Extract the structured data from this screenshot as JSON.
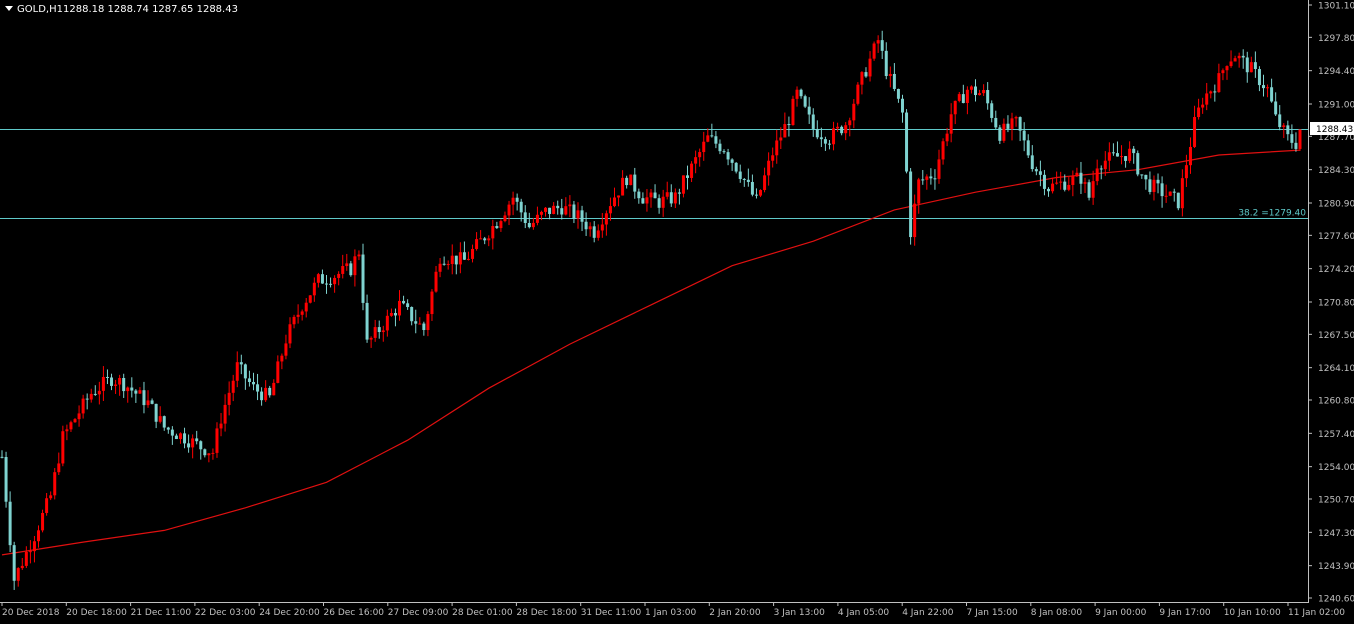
{
  "header": {
    "symbol_timeframe": "GOLD,H1",
    "ohlc": "1288.18 1288.74 1287.65 1288.43"
  },
  "colors": {
    "background": "#000000",
    "bull_candle": "#ff0000",
    "bear_candle": "#7fd3d0",
    "ma_line": "#e01010",
    "hline": "#5fc9c9",
    "axis": "#c0c0c0",
    "price_tag_bg": "#ffffff"
  },
  "price_tag": "1288.43",
  "chart_data": {
    "type": "candlestick",
    "ylim": [
      1240.6,
      1301.1
    ],
    "y_ticks": [
      "1301.10",
      "1297.80",
      "1294.40",
      "1291.00",
      "1287.70",
      "1284.30",
      "1280.90",
      "1277.60",
      "1274.20",
      "1270.80",
      "1267.50",
      "1264.10",
      "1260.80",
      "1257.40",
      "1254.00",
      "1250.70",
      "1247.30",
      "1243.90",
      "1240.60"
    ],
    "x_ticks": [
      "20 Dec 2018",
      "20 Dec 18:00",
      "21 Dec 11:00",
      "22 Dec 03:00",
      "24 Dec 20:00",
      "26 Dec 16:00",
      "27 Dec 09:00",
      "28 Dec 01:00",
      "28 Dec 18:00",
      "31 Dec 11:00",
      "1 Jan 03:00",
      "2 Jan 20:00",
      "3 Jan 13:00",
      "4 Jan 05:00",
      "4 Jan 22:00",
      "7 Jan 15:00",
      "8 Jan 08:00",
      "9 Jan 00:00",
      "9 Jan 17:00",
      "10 Jan 10:00",
      "11 Jan 02:00"
    ],
    "hlines": [
      {
        "value": 1288.43,
        "label": ""
      },
      {
        "value": 1279.4,
        "label": "38.2 =1279.40"
      }
    ],
    "ma_points": [
      [
        0,
        1245.0
      ],
      [
        1,
        1246.3
      ],
      [
        2,
        1247.5
      ],
      [
        3,
        1249.8
      ],
      [
        4,
        1252.4
      ],
      [
        5,
        1256.7
      ],
      [
        6,
        1262.0
      ],
      [
        7,
        1266.5
      ],
      [
        8,
        1270.5
      ],
      [
        9,
        1274.5
      ],
      [
        10,
        1277.0
      ],
      [
        11,
        1280.2
      ],
      [
        12,
        1282.0
      ],
      [
        13,
        1283.5
      ],
      [
        14,
        1284.3
      ],
      [
        15,
        1285.8
      ],
      [
        16,
        1286.3
      ]
    ],
    "anchors": [
      [
        0,
        1255.0
      ],
      [
        3,
        1242.5
      ],
      [
        8,
        1247.0
      ],
      [
        12,
        1251.0
      ],
      [
        15,
        1257.0
      ],
      [
        22,
        1261.5
      ],
      [
        27,
        1263.0
      ],
      [
        30,
        1262.5
      ],
      [
        36,
        1260.5
      ],
      [
        40,
        1258.0
      ],
      [
        45,
        1257.0
      ],
      [
        49,
        1256.0
      ],
      [
        52,
        1255.5
      ],
      [
        54,
        1259.0
      ],
      [
        58,
        1264.2
      ],
      [
        62,
        1262.0
      ],
      [
        66,
        1261.0
      ],
      [
        70,
        1267.0
      ],
      [
        74,
        1270.5
      ],
      [
        78,
        1273.0
      ],
      [
        82,
        1273.5
      ],
      [
        86,
        1274.2
      ],
      [
        88,
        1276.0
      ],
      [
        90,
        1266.5
      ],
      [
        94,
        1268.5
      ],
      [
        98,
        1270.5
      ],
      [
        104,
        1268.0
      ],
      [
        108,
        1275.5
      ],
      [
        114,
        1275.0
      ],
      [
        118,
        1277.0
      ],
      [
        122,
        1279.0
      ],
      [
        126,
        1281.5
      ],
      [
        130,
        1278.5
      ],
      [
        134,
        1280.0
      ],
      [
        138,
        1280.5
      ],
      [
        142,
        1279.5
      ],
      [
        146,
        1278.0
      ],
      [
        150,
        1281.0
      ],
      [
        154,
        1283.5
      ],
      [
        158,
        1281.5
      ],
      [
        162,
        1281.0
      ],
      [
        166,
        1281.5
      ],
      [
        170,
        1284.5
      ],
      [
        174,
        1287.5
      ],
      [
        178,
        1286.5
      ],
      [
        182,
        1284.0
      ],
      [
        186,
        1281.0
      ],
      [
        190,
        1286.0
      ],
      [
        194,
        1289.5
      ],
      [
        196,
        1292.0
      ],
      [
        200,
        1288.5
      ],
      [
        204,
        1287.5
      ],
      [
        208,
        1289.0
      ],
      [
        212,
        1293.5
      ],
      [
        214,
        1295.5
      ],
      [
        216,
        1297.5
      ],
      [
        218,
        1294.5
      ],
      [
        222,
        1290.0
      ],
      [
        224,
        1278.0
      ],
      [
        226,
        1283.0
      ],
      [
        230,
        1284.0
      ],
      [
        234,
        1290.0
      ],
      [
        238,
        1292.5
      ],
      [
        242,
        1292.0
      ],
      [
        246,
        1288.0
      ],
      [
        250,
        1289.0
      ],
      [
        254,
        1285.0
      ],
      [
        258,
        1282.5
      ],
      [
        262,
        1283.0
      ],
      [
        266,
        1283.5
      ],
      [
        268,
        1281.5
      ],
      [
        270,
        1285.0
      ],
      [
        274,
        1285.5
      ],
      [
        278,
        1286.0
      ],
      [
        282,
        1283.0
      ],
      [
        286,
        1282.0
      ],
      [
        290,
        1281.0
      ],
      [
        292,
        1285.0
      ],
      [
        294,
        1289.0
      ],
      [
        296,
        1291.5
      ],
      [
        300,
        1293.5
      ],
      [
        302,
        1295.5
      ],
      [
        304,
        1296.0
      ],
      [
        308,
        1294.5
      ],
      [
        312,
        1292.5
      ],
      [
        314,
        1289.5
      ],
      [
        317,
        1287.5
      ],
      [
        319,
        1287.0
      ],
      [
        320,
        1288.43
      ]
    ]
  }
}
